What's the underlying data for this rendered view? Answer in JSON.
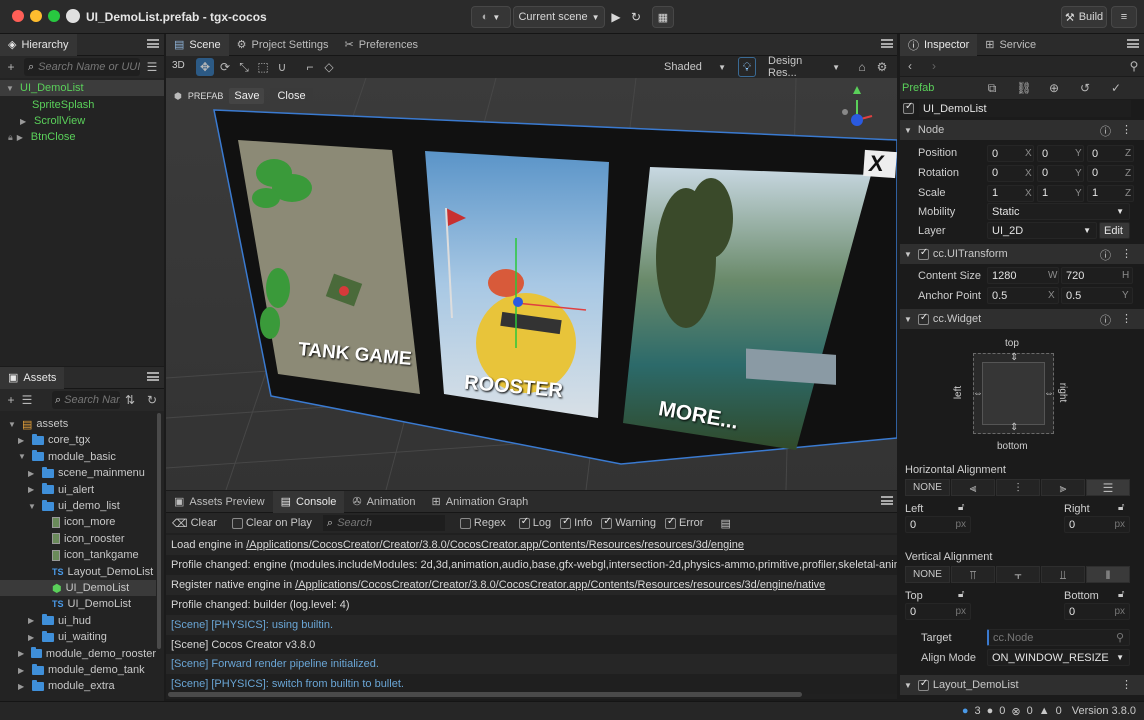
{
  "window": {
    "title": "UI_DemoList.prefab - tgx-cocos",
    "scene_select": "Current scene",
    "build": "Build"
  },
  "hierarchy": {
    "tab": "Hierarchy",
    "search_placeholder": "Search Name or UUID",
    "items": [
      "UI_DemoList",
      "SpriteSplash",
      "ScrollView",
      "BtnClose"
    ]
  },
  "assets": {
    "tab": "Assets",
    "search_placeholder": "Search Name",
    "items": [
      {
        "label": "assets",
        "kind": "db"
      },
      {
        "label": "core_tgx",
        "kind": "folder"
      },
      {
        "label": "module_basic",
        "kind": "folder"
      },
      {
        "label": "scene_mainmenu",
        "kind": "folder"
      },
      {
        "label": "ui_alert",
        "kind": "folder"
      },
      {
        "label": "ui_demo_list",
        "kind": "folder"
      },
      {
        "label": "icon_more",
        "kind": "image"
      },
      {
        "label": "icon_rooster",
        "kind": "image"
      },
      {
        "label": "icon_tankgame",
        "kind": "image"
      },
      {
        "label": "Layout_DemoList",
        "kind": "ts"
      },
      {
        "label": "UI_DemoList",
        "kind": "prefab"
      },
      {
        "label": "UI_DemoList",
        "kind": "ts"
      },
      {
        "label": "ui_hud",
        "kind": "folder"
      },
      {
        "label": "ui_waiting",
        "kind": "folder"
      },
      {
        "label": "module_demo_rooster",
        "kind": "folder"
      },
      {
        "label": "module_demo_tank",
        "kind": "folder"
      },
      {
        "label": "module_extra",
        "kind": "folder"
      }
    ]
  },
  "scene": {
    "tabs": [
      "Scene",
      "Project Settings",
      "Preferences"
    ],
    "mode3d": "3D",
    "shading": "Shaded",
    "design": "Design Res...",
    "prefab_label": "PREFAB",
    "save": "Save",
    "close": "Close",
    "cards": [
      "TANK GAME",
      "ROOSTER",
      "MORE..."
    ],
    "close_glyph": "X"
  },
  "console": {
    "tabs": [
      "Assets Preview",
      "Console",
      "Animation",
      "Animation Graph"
    ],
    "clear": "Clear",
    "clear_on_play": "Clear on Play",
    "search_placeholder": "Search",
    "filters": [
      "Regex",
      "Log",
      "Info",
      "Warning",
      "Error"
    ],
    "lines": [
      {
        "prefix": "Load engine in ",
        "link": "/Applications/CocosCreator/Creator/3.8.0/CocosCreator.app/Contents/Resources/resources/3d/engine",
        "color": "#d8d8d8"
      },
      {
        "prefix": "Profile changed: engine (modules.includeModules: 2d,3d,animation,audio,base,gfx-webgl,intersection-2d,physics-ammo,primitive,profiler,skeletal-animation",
        "link": "",
        "color": "#d8d8d8"
      },
      {
        "prefix": "Register native engine in ",
        "link": "/Applications/CocosCreator/Creator/3.8.0/CocosCreator.app/Contents/Resources/resources/3d/engine/native",
        "color": "#d8d8d8"
      },
      {
        "prefix": "Profile changed: builder (log.level: 4)",
        "link": "",
        "color": "#d8d8d8"
      },
      {
        "prefix": "[Scene] [PHYSICS]: using builtin.",
        "link": "",
        "color": "#6aa6d6"
      },
      {
        "prefix": "[Scene] Cocos Creator v3.8.0",
        "link": "",
        "color": "#d8d8d8"
      },
      {
        "prefix": "[Scene] Forward render pipeline initialized.",
        "link": "",
        "color": "#6aa6d6"
      },
      {
        "prefix": "[Scene] [PHYSICS]: switch from builtin to bullet.",
        "link": "",
        "color": "#6aa6d6"
      }
    ]
  },
  "inspector": {
    "tabs": [
      "Inspector",
      "Service"
    ],
    "prefab": "Prefab",
    "node_name": "UI_DemoList",
    "node": {
      "title": "Node",
      "position": [
        "0",
        "0",
        "0"
      ],
      "rotation": [
        "0",
        "0",
        "0"
      ],
      "scale": [
        "1",
        "1",
        "1"
      ],
      "mobility": "Static",
      "layer": "UI_2D",
      "edit": "Edit",
      "labels": [
        "Position",
        "Rotation",
        "Scale",
        "Mobility",
        "Layer"
      ]
    },
    "uitransform": {
      "title": "cc.UITransform",
      "content_size_label": "Content Size",
      "anchor_point_label": "Anchor Point",
      "content_size": [
        "1280",
        "720"
      ],
      "anchor_point": [
        "0.5",
        "0.5"
      ]
    },
    "widget": {
      "title": "cc.Widget",
      "top": "top",
      "bottom": "bottom",
      "left": "left",
      "right": "right",
      "h_align_label": "Horizontal Alignment",
      "v_align_label": "Vertical Alignment",
      "none": "NONE",
      "left_label": "Left",
      "right_label": "Right",
      "top_label": "Top",
      "bottom_label": "Bottom",
      "left_val": "0",
      "right_val": "0",
      "top_val": "0",
      "bottom_val": "0",
      "unit": "px",
      "target_label": "Target",
      "target_placeholder": "cc.Node",
      "align_mode_label": "Align Mode",
      "align_mode": "ON_WINDOW_RESIZE"
    },
    "layout": {
      "title": "Layout_DemoList"
    }
  },
  "axis_labels": {
    "x": "X",
    "y": "Y",
    "z": "Z",
    "w": "W",
    "h": "H"
  },
  "status": {
    "info": "3",
    "err1": "0",
    "err2": "0",
    "warn": "0",
    "version": "Version 3.8.0"
  }
}
